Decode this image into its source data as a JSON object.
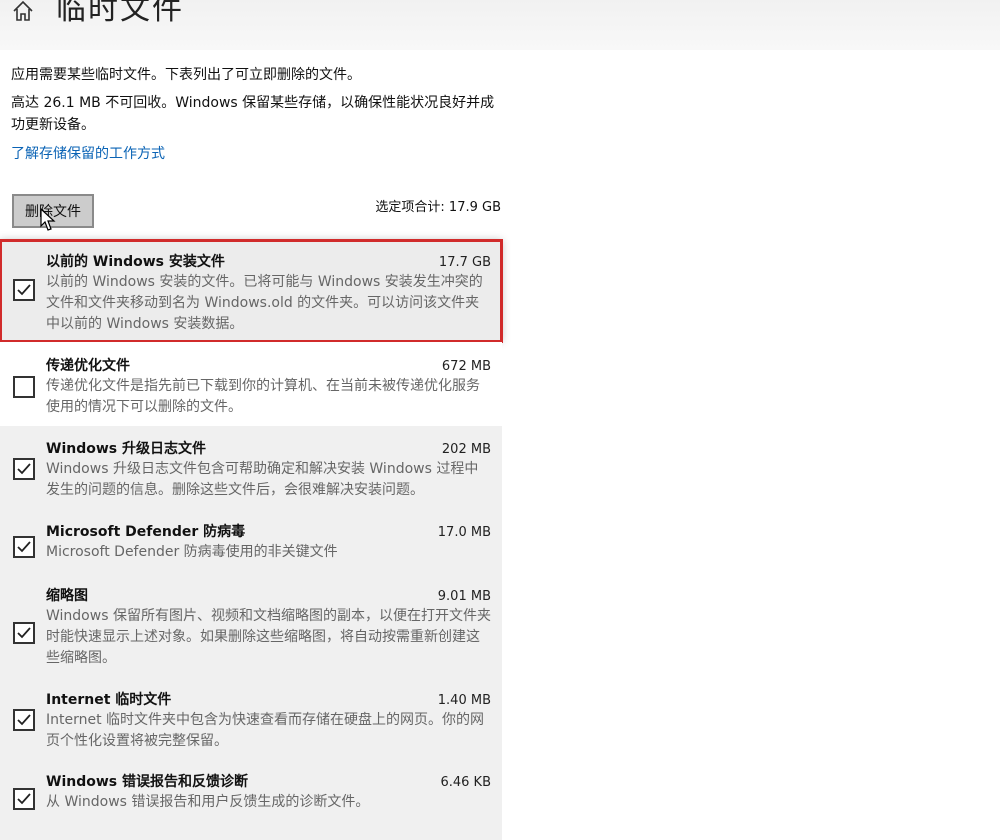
{
  "header": {
    "title": "临时文件",
    "home_icon": "home-icon"
  },
  "intro": {
    "line1": "应用需要某些临时文件。下表列出了可立即删除的文件。",
    "line2": "高达 26.1 MB 不可回收。Windows 保留某些存储，以确保性能状况良好并成功更新设备。",
    "link": "了解存储保留的工作方式"
  },
  "actions": {
    "delete_label": "删除文件",
    "total_label": "选定项合计: 17.9 GB"
  },
  "colors": {
    "accent_link": "#0a63b5",
    "highlight_border": "#d12b2b"
  },
  "items": [
    {
      "title": "以前的 Windows 安装文件",
      "size": "17.7 GB",
      "desc": "以前的 Windows 安装的文件。已将可能与 Windows 安装发生冲突的文件和文件夹移动到名为 Windows.old 的文件夹。可以访问该文件夹中以前的 Windows 安装数据。",
      "checked": true
    },
    {
      "title": "传递优化文件",
      "size": "672 MB",
      "desc": "传递优化文件是指先前已下载到你的计算机、在当前未被传递优化服务使用的情况下可以删除的文件。",
      "checked": false
    },
    {
      "title": "Windows 升级日志文件",
      "size": "202 MB",
      "desc": "Windows 升级日志文件包含可帮助确定和解决安装 Windows 过程中发生的问题的信息。删除这些文件后，会很难解决安装问题。",
      "checked": true
    },
    {
      "title": "Microsoft Defender 防病毒",
      "size": "17.0 MB",
      "desc": "Microsoft Defender 防病毒使用的非关键文件",
      "checked": true
    },
    {
      "title": "缩略图",
      "size": "9.01 MB",
      "desc": "Windows 保留所有图片、视频和文档缩略图的副本，以便在打开文件夹时能快速显示上述对象。如果删除这些缩略图，将自动按需重新创建这些缩略图。",
      "checked": true
    },
    {
      "title": "Internet 临时文件",
      "size": "1.40 MB",
      "desc": "Internet 临时文件夹中包含为快速查看而存储在硬盘上的网页。你的网页个性化设置将被完整保留。",
      "checked": true
    },
    {
      "title": "Windows 错误报告和反馈诊断",
      "size": "6.46 KB",
      "desc": "从 Windows 错误报告和用户反馈生成的诊断文件。",
      "checked": true
    }
  ]
}
